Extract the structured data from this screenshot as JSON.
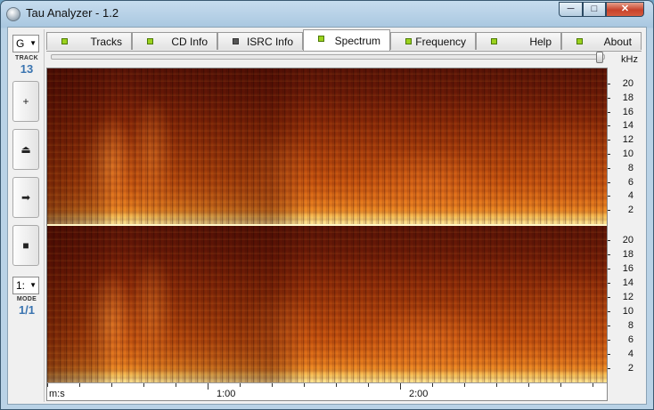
{
  "window": {
    "title": "Tau Analyzer - 1.2",
    "min_glyph": "─",
    "max_glyph": "□",
    "close_glyph": "✕"
  },
  "left_panel": {
    "drive_combo": "G",
    "track_label": "TRACK",
    "track_value": "13",
    "mode_combo": "1:",
    "mode_label": "MODE",
    "mode_value": "1/1",
    "buttons": [
      {
        "name": "zoom-in-button",
        "glyph": "+"
      },
      {
        "name": "eject-button",
        "glyph": "⏏"
      },
      {
        "name": "play-button",
        "glyph": "➡"
      },
      {
        "name": "stop-button",
        "glyph": "■"
      }
    ]
  },
  "tabs": [
    {
      "label": "Tracks",
      "led": "green"
    },
    {
      "label": "CD Info",
      "led": "green"
    },
    {
      "label": "ISRC Info",
      "led": "grey"
    },
    {
      "label": "Spectrum",
      "led": "green",
      "active": true
    },
    {
      "label": "Frequency",
      "led": "green"
    },
    {
      "label": "Help",
      "led": "green"
    },
    {
      "label": "About",
      "led": "green"
    }
  ],
  "spectrum": {
    "freq_unit": "kHz",
    "freq_labels": [
      "20",
      "18",
      "16",
      "14",
      "12",
      "10",
      "8",
      "6",
      "4",
      "2"
    ],
    "time_unit_label": "m:s",
    "time_labels": [
      "1:00",
      "2:00"
    ],
    "colors": {
      "low": "#5a1406",
      "mid": "#c9570f",
      "high": "#fff2a6"
    }
  }
}
